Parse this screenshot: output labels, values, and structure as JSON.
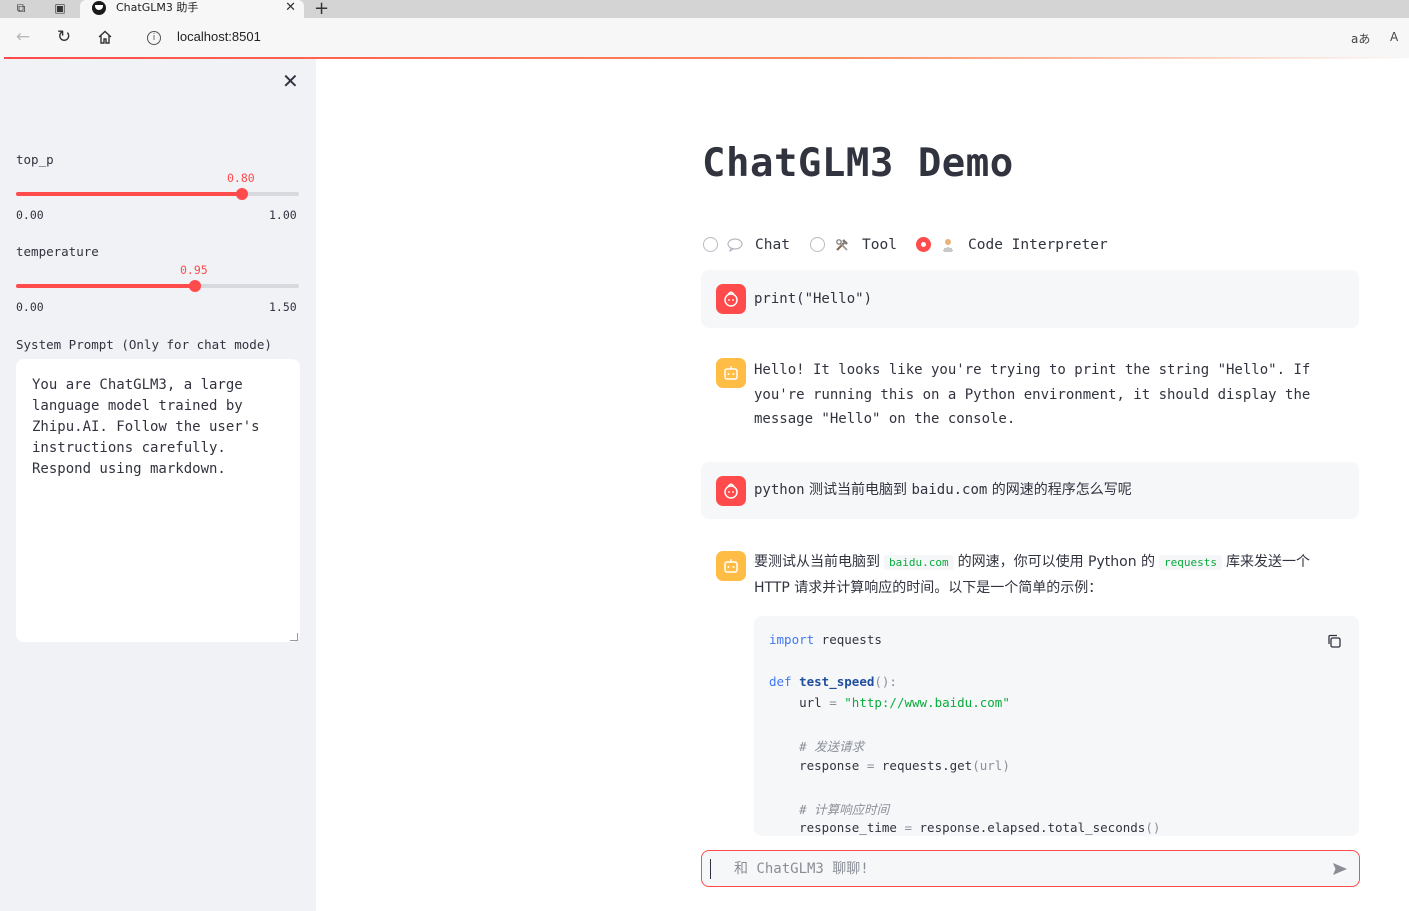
{
  "browser": {
    "tab_title": "ChatGLM3 助手",
    "tab_close": "✕",
    "new_tab": "+",
    "url": "localhost:8501",
    "read_aloud": "A",
    "translate": "aあ"
  },
  "sidebar": {
    "close": "✕",
    "top_p": {
      "label": "top_p",
      "value": "0.80",
      "min": "0.00",
      "max": "1.00",
      "fraction": 0.8
    },
    "temperature": {
      "label": "temperature",
      "value": "0.95",
      "min": "0.00",
      "max": "1.50",
      "fraction": 0.6333
    },
    "system_prompt_label": "System Prompt (Only for chat mode)",
    "system_prompt_value": "You are ChatGLM3, a large\nlanguage model trained by\nZhipu.AI. Follow the user's\ninstructions carefully.\nRespond using markdown."
  },
  "main": {
    "title": "ChatGLM3 Demo",
    "modes": [
      {
        "label": "Chat",
        "emoji": "💬",
        "selected": false
      },
      {
        "label": "Tool",
        "emoji": "🛠",
        "selected": false
      },
      {
        "label": "Code Interpreter",
        "emoji": "🧑‍💻",
        "selected": true
      }
    ],
    "messages": [
      {
        "role": "user",
        "text": "print(\"Hello\")"
      },
      {
        "role": "assistant",
        "text": "Hello! It looks like you're trying to print the string \"Hello\". If you're running this on a Python environment, it should display the message \"Hello\" on the console."
      },
      {
        "role": "user",
        "text_a": "python",
        "text_b": " 测试当前电脑到 ",
        "text_c": "baidu.com",
        "text_d": " 的网速的程序怎么写呢"
      },
      {
        "role": "assistant",
        "part1": "要测试从当前电脑到",
        "code1": "baidu.com",
        "part2": "的网速，你可以使用",
        "part3": " Python ",
        "part4": "的",
        "code2": "requests",
        "part5": "库来发送一个",
        "part6": " HTTP ",
        "part7": "请求并计算响应的时间。以下是一个简单的示例："
      }
    ],
    "code": {
      "l1_kw": "import",
      "l1_rest": " requests",
      "l2_kw": "def",
      "l2_fn": "test_speed",
      "l2_rest": "():",
      "l3_a": "    url ",
      "l3_op": "=",
      "l3_str": " \"http://www.baidu.com\"",
      "l4_cm": "    # 发送请求",
      "l5_a": "    response ",
      "l5_op": "=",
      "l5_b": " requests",
      "l5_c": ".get",
      "l5_d": "(url)",
      "l6_cm": "    # 计算响应时间",
      "l7_a": "    response_time ",
      "l7_op": "=",
      "l7_b": " response",
      "l7_c": ".elapsed.total_seconds",
      "l7_d": "()"
    },
    "input_placeholder": "和 ChatGLM3 聊聊!"
  }
}
